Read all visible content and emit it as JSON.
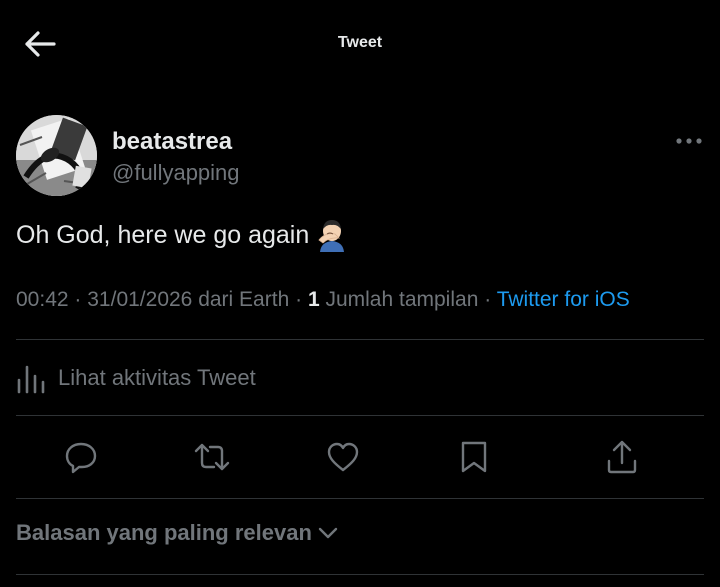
{
  "header": {
    "title": "Tweet",
    "back_icon": "arrow-left-icon"
  },
  "author": {
    "display_name": "beatastrea",
    "handle": "@fullyapping",
    "more_icon": "more-horizontal-icon"
  },
  "tweet": {
    "text": "Oh God, here we go again",
    "emoji_icon": "person-facepalming-icon"
  },
  "meta": {
    "time": "00:42",
    "date": "31/01/2026",
    "location": "dari Earth",
    "views_count": "1",
    "views_label": "Jumlah tampilan",
    "source": "Twitter for iOS",
    "separator": "·"
  },
  "activity": {
    "label": "Lihat aktivitas Tweet",
    "icon": "analytics-icon"
  },
  "actions": [
    {
      "name": "reply",
      "icon": "reply-icon"
    },
    {
      "name": "retweet",
      "icon": "retweet-icon"
    },
    {
      "name": "like",
      "icon": "heart-icon"
    },
    {
      "name": "bookmark",
      "icon": "bookmark-icon"
    },
    {
      "name": "share",
      "icon": "share-icon"
    }
  ],
  "replies": {
    "sort_label": "Balasan yang paling relevan",
    "chevron_icon": "chevron-down-icon"
  },
  "colors": {
    "background": "#000000",
    "text_primary": "#e7e9ea",
    "text_secondary": "#71767b",
    "link": "#1d9bf0",
    "divider": "#2f3336"
  }
}
